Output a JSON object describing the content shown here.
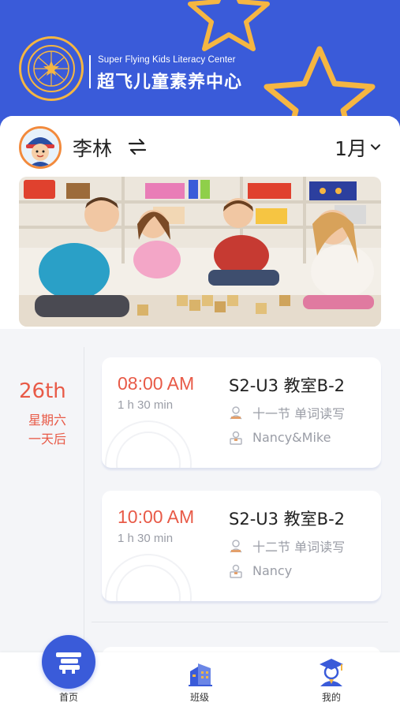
{
  "header": {
    "brand_en": "Super Flying Kids Literacy Center",
    "brand_cn": "超飞儿童素养中心",
    "brand_color": "#3a5bd9",
    "accent_color": "#f5b642"
  },
  "profile": {
    "student_name": "李林",
    "switch_icon": "swap-icon",
    "month": "1月"
  },
  "schedule": {
    "day": "26th",
    "weekday": "星期六",
    "relative": "一天后",
    "lessons": [
      {
        "time": "08:00 AM",
        "duration": "1 h 30 min",
        "title": "S2-U3 教室B-2",
        "session": "十一节 单词读写",
        "teacher": "Nancy&Mike"
      },
      {
        "time": "10:00 AM",
        "duration": "1 h 30 min",
        "title": "S2-U3 教室B-2",
        "session": "十二节 单词读写",
        "teacher": "Nancy"
      }
    ]
  },
  "tabbar": {
    "home": "首页",
    "classes": "班级",
    "mine": "我的"
  }
}
